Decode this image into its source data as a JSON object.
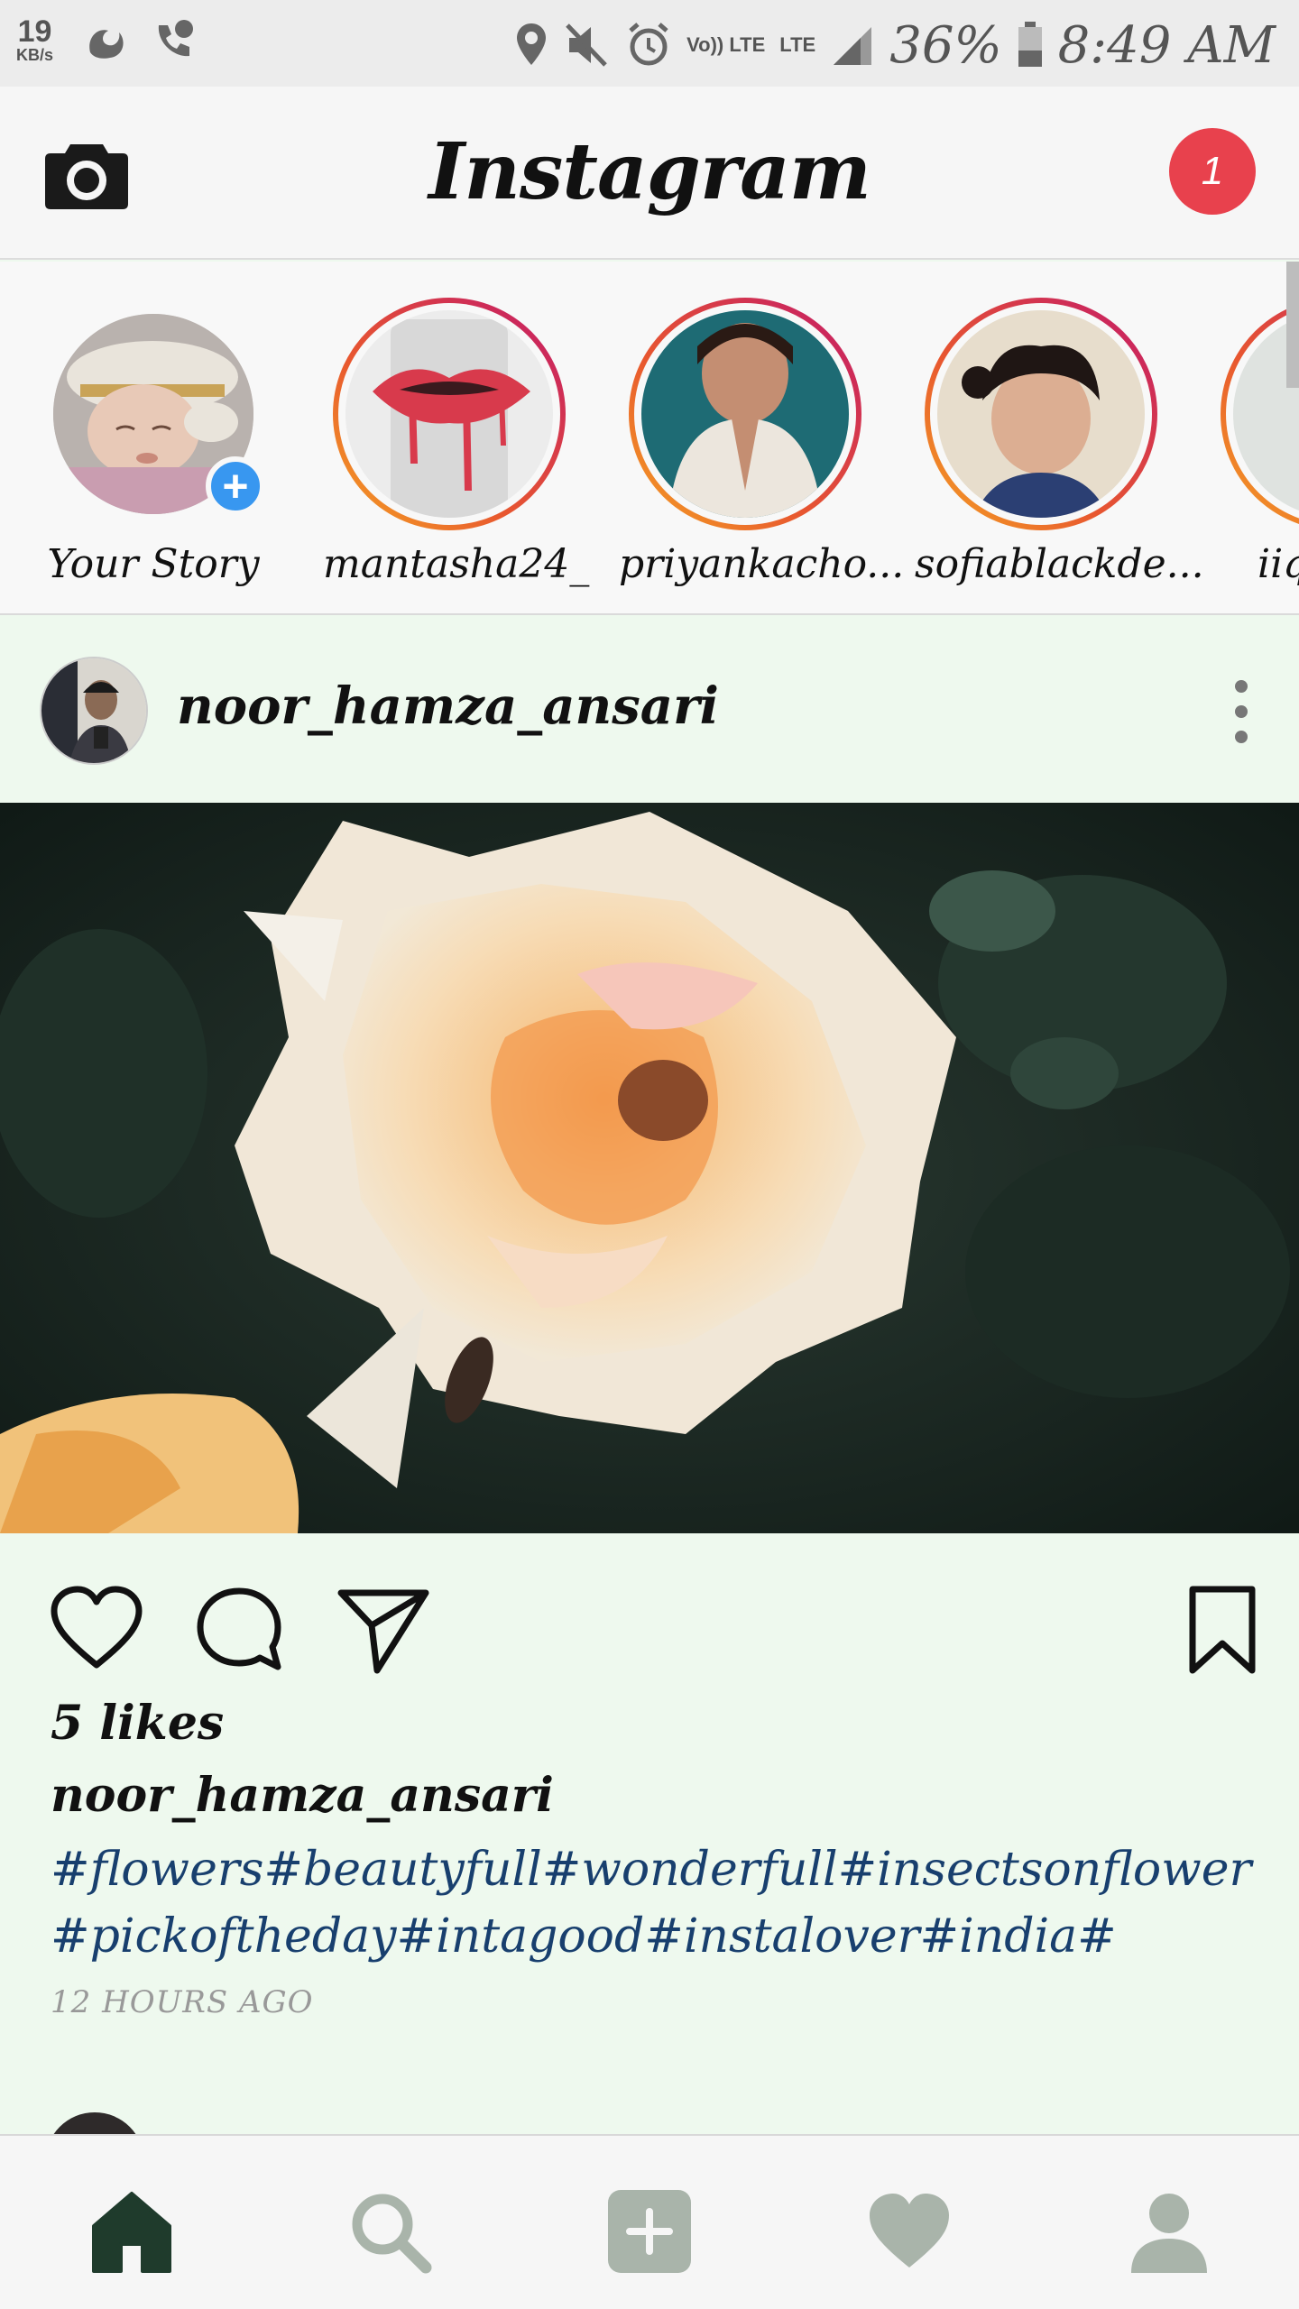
{
  "status_bar": {
    "net_speed": "19",
    "net_unit": "KB/s",
    "volte": "Vo)) LTE",
    "lte": "LTE",
    "battery": "36%",
    "time": "8:49 AM"
  },
  "header": {
    "title": "Instagram",
    "notification_count": "1"
  },
  "stories": [
    {
      "label": "Your Story"
    },
    {
      "label": "mantasha24_"
    },
    {
      "label": "priyankacho..."
    },
    {
      "label": "sofiablackde..."
    },
    {
      "label": "iiq"
    }
  ],
  "post": {
    "username": "noor_hamza_ansari",
    "likes": "5 likes",
    "caption_user": "noor_hamza_ansari",
    "hashtags_line1": "#flowers#beautyfull#wonderfull#insectsonflower",
    "hashtags_line2": "#pickoftheday#intagood#instalover#india#",
    "time_ago": "12 HOURS AGO"
  },
  "icons": {
    "camera": "camera-icon",
    "like": "heart-outline-icon",
    "comment": "comment-icon",
    "share": "paper-plane-icon",
    "save": "bookmark-icon",
    "home": "home-icon",
    "search": "search-icon",
    "add": "plus-square-icon",
    "activity": "heart-filled-icon",
    "profile": "person-icon"
  },
  "colors": {
    "notification": "#e8414d",
    "add_story": "#3897f0",
    "hashtag": "#183f6e",
    "nav_active": "#1f3b2c",
    "nav_inactive": "#a9b4aa"
  }
}
